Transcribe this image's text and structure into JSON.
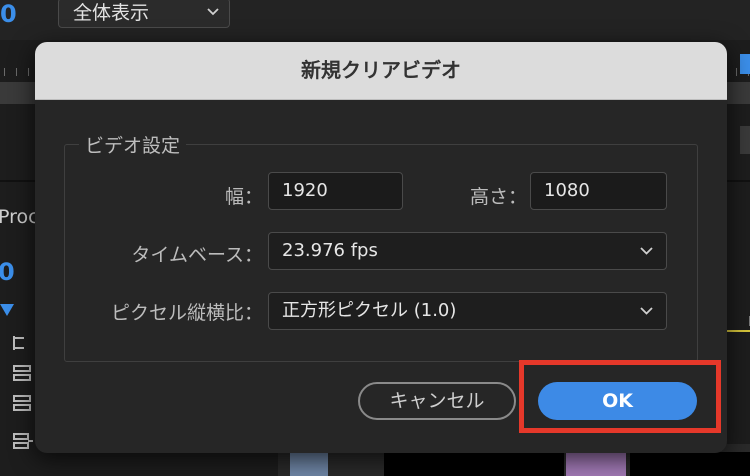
{
  "background": {
    "counter_top": "0",
    "view_select": "全体表示",
    "panel_title": "Proc",
    "counter_mid": "0"
  },
  "dialog": {
    "title": "新規クリアビデオ",
    "group_label": "ビデオ設定",
    "width_label": "幅：",
    "width_value": "1920",
    "height_label": "高さ：",
    "height_value": "1080",
    "timebase_label": "タイムベース：",
    "timebase_value": "23.976 fps",
    "pixel_aspect_label": "ピクセル縦横比：",
    "pixel_aspect_value": "正方形ピクセル (1.0)",
    "cancel_label": "キャンセル",
    "ok_label": "OK"
  },
  "colors": {
    "accent": "#3d8ae6",
    "highlight_box": "#e5382a",
    "title_bar": "#dcdcdc",
    "dialog_bg": "#262626"
  },
  "icons": [
    "chevron-down-icon",
    "track-toggle-icon"
  ]
}
